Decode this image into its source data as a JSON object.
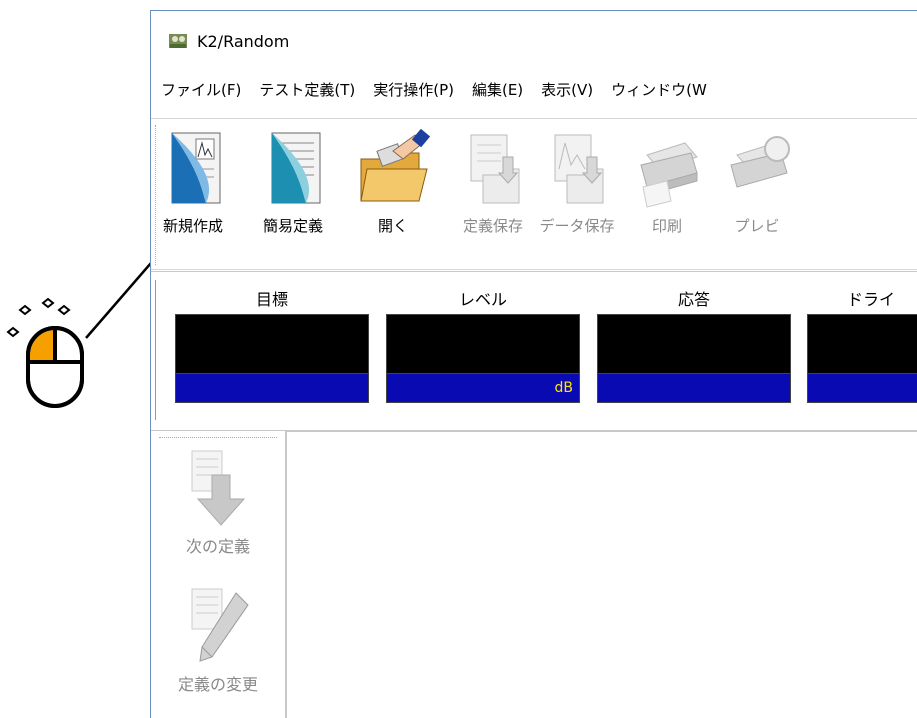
{
  "window": {
    "title": "K2/Random"
  },
  "menu": {
    "items": [
      "ファイル(F)",
      "テスト定義(T)",
      "実行操作(P)",
      "編集(E)",
      "表示(V)",
      "ウィンドウ(W"
    ]
  },
  "toolbar": {
    "buttons": [
      {
        "label": "新規作成",
        "icon": "new-document-icon",
        "enabled": true
      },
      {
        "label": "簡易定義",
        "icon": "simple-definition-icon",
        "enabled": true
      },
      {
        "label": "開く",
        "icon": "open-folder-icon",
        "enabled": true
      },
      {
        "label": "定義保存",
        "icon": "save-definition-icon",
        "enabled": false
      },
      {
        "label": "データ保存",
        "icon": "save-data-icon",
        "enabled": false
      },
      {
        "label": "印刷",
        "icon": "printer-icon",
        "enabled": false
      },
      {
        "label": "プレビ",
        "icon": "print-preview-icon",
        "enabled": false
      }
    ]
  },
  "meters": [
    {
      "label": "目標",
      "unit": ""
    },
    {
      "label": "レベル",
      "unit": "dB"
    },
    {
      "label": "応答",
      "unit": ""
    },
    {
      "label": "ドライ",
      "unit": ""
    }
  ],
  "sidebar": {
    "buttons": [
      {
        "label": "次の定義",
        "icon": "next-definition-icon",
        "enabled": false
      },
      {
        "label": "定義の変更",
        "icon": "edit-definition-icon",
        "enabled": false
      }
    ]
  },
  "annotation": {
    "icon": "mouse-left-click-icon",
    "highlight_color": "#f5a000"
  }
}
